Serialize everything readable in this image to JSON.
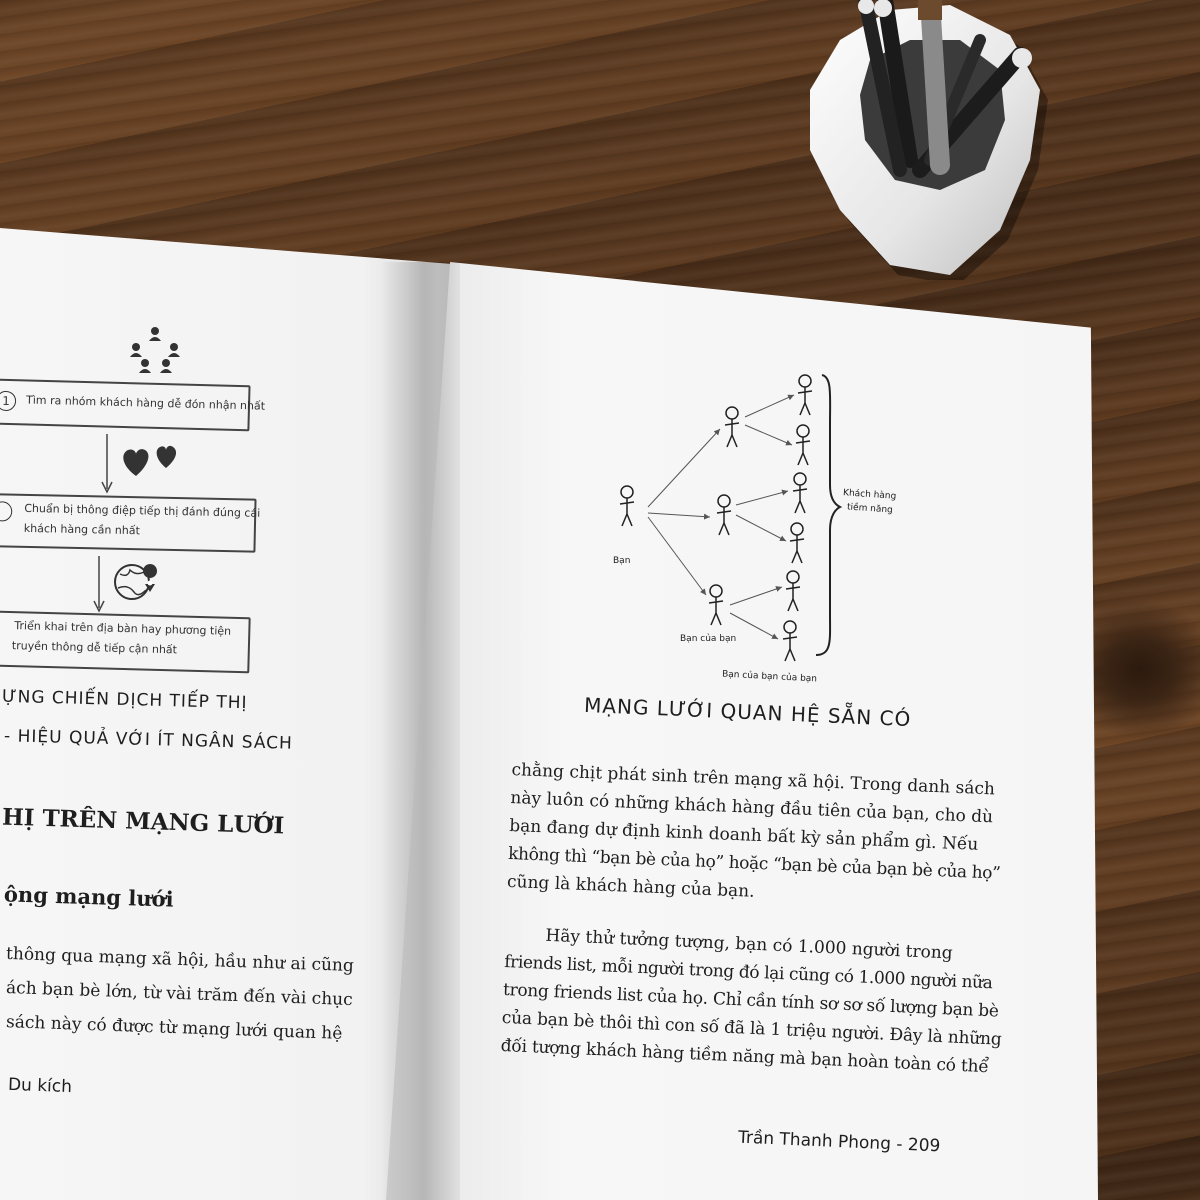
{
  "left_page": {
    "flowchart": {
      "steps": [
        {
          "number": "1",
          "text": "Tìm ra nhóm khách hàng dễ đón nhận nhất"
        },
        {
          "text_line1": "Chuẩn bị thông điệp tiếp thị đánh đúng cái",
          "text_line2": "khách hàng cần nhất"
        },
        {
          "text_line1": "Triển khai trên địa bàn hay phương tiện",
          "text_line2": "truyền thông dễ tiếp cận nhất"
        }
      ]
    },
    "caption_line1": "ựng chiến dịch tiếp thị",
    "caption_line2": "- hiệu quả với ít ngân sách",
    "section_title": "hị trên mạng lưới",
    "subsection_title": "ộng mạng lưới",
    "body_lines": [
      "thông qua mạng xã hội, hầu như ai cũng",
      "ách bạn bè lớn, từ vài trăm đến vài chục",
      "sách này có được từ mạng lưới quan hệ"
    ],
    "footer": "Du kích"
  },
  "right_page": {
    "diagram": {
      "label_you": "Bạn",
      "label_friends": "Bạn của bạn",
      "label_friends_of_friends": "Bạn của bạn của bạn",
      "label_potential_line1": "Khách hàng",
      "label_potential_line2": "tiềm năng"
    },
    "diagram_title": "Mạng lưới quan hệ sẵn có",
    "paragraph1": [
      "chằng chịt phát sinh trên mạng xã hội. Trong danh sách",
      "này luôn có những khách hàng đầu tiên của bạn, cho dù",
      "bạn đang dự định kinh doanh bất kỳ sản phẩm gì. Nếu",
      "không thì “bạn bè của họ” hoặc “bạn bè của bạn bè của họ”",
      "cũng là khách hàng của bạn."
    ],
    "paragraph2": [
      "Hãy thử tưởng tượng, bạn có 1.000 người trong",
      "friends list, mỗi người trong đó lại cũng có 1.000 người nữa",
      "trong friends list của họ. Chỉ cần tính sơ sơ số lượng bạn bè",
      "của bạn bè thôi thì con số đã là 1 triệu người. Đây là những",
      "đối tượng khách hàng tiềm năng mà bạn hoàn toàn có thể"
    ],
    "footer": "Trần Thanh Phong - 209"
  }
}
